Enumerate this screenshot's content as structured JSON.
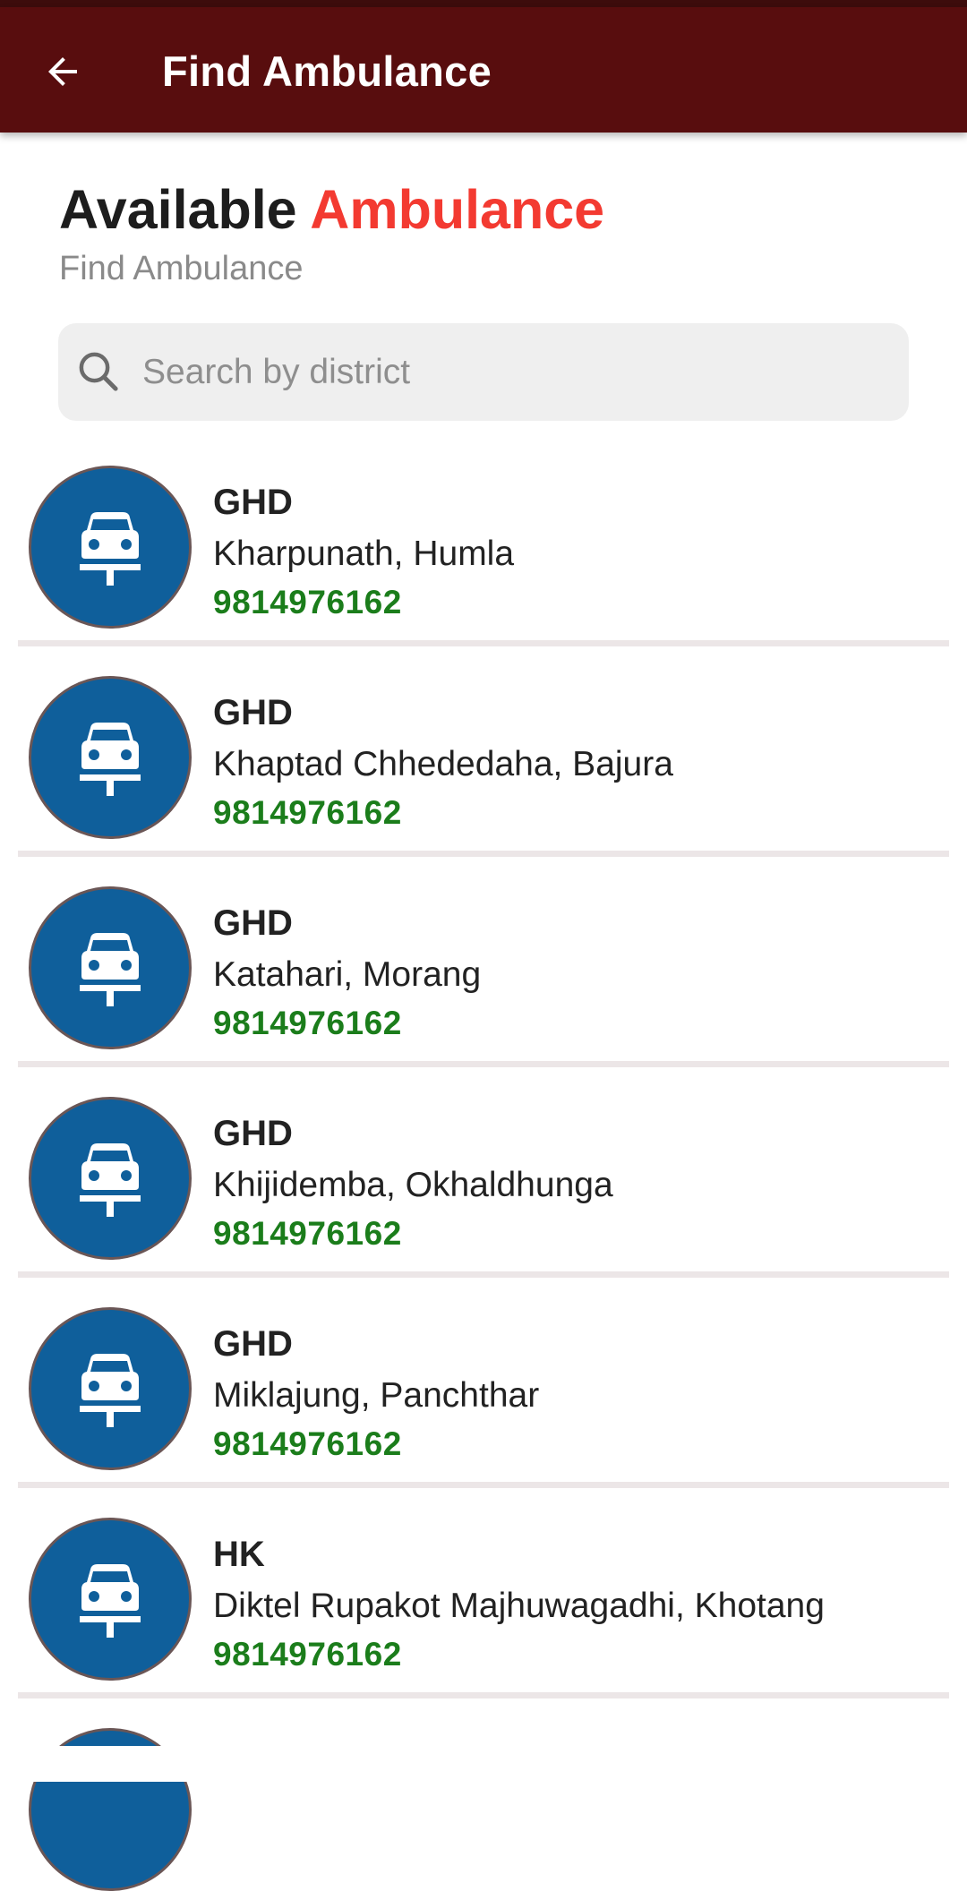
{
  "app_bar": {
    "title": "Find Ambulance",
    "back_icon": "arrow-left-icon",
    "color": "#580d0e"
  },
  "header": {
    "title_part1": "Available",
    "title_part2": "Ambulance",
    "accent_color": "#f33a31",
    "subtitle": "Find Ambulance"
  },
  "search": {
    "placeholder": "Search by district",
    "value": "",
    "icon": "search-icon"
  },
  "ambulances": [
    {
      "name": "GHD",
      "location": "Kharpunath, Humla",
      "phone": "9814976162",
      "icon": "ambulance-icon"
    },
    {
      "name": "GHD",
      "location": "Khaptad Chhededaha, Bajura",
      "phone": "9814976162",
      "icon": "ambulance-icon"
    },
    {
      "name": "GHD",
      "location": "Katahari, Morang",
      "phone": "9814976162",
      "icon": "ambulance-icon"
    },
    {
      "name": "GHD",
      "location": "Khijidemba, Okhaldhunga",
      "phone": "9814976162",
      "icon": "ambulance-icon"
    },
    {
      "name": "GHD",
      "location": "Miklajung, Panchthar",
      "phone": "9814976162",
      "icon": "ambulance-icon"
    },
    {
      "name": "HK",
      "location": "Diktel Rupakot Majhuwagadhi, Khotang",
      "phone": "9814976162",
      "icon": "ambulance-icon"
    }
  ],
  "colors": {
    "avatar_bg": "#0f5f9b",
    "phone": "#1b7d1b"
  }
}
